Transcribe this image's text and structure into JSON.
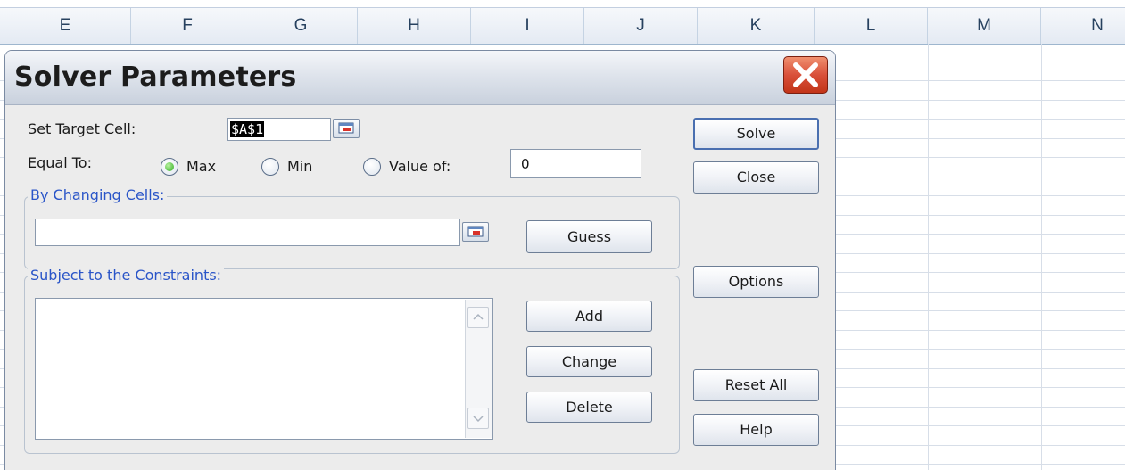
{
  "spreadsheet": {
    "columns": [
      "E",
      "F",
      "G",
      "H",
      "I",
      "J",
      "K",
      "L",
      "M",
      "N"
    ]
  },
  "dialog": {
    "title": "Solver Parameters",
    "close_icon": "close-icon",
    "set_target_cell": {
      "label": "Set Target Cell:",
      "value": "$A$1",
      "ref_icon": "range-select-icon"
    },
    "equal_to": {
      "label": "Equal To:",
      "options": [
        {
          "label": "Max",
          "selected": true
        },
        {
          "label": "Min",
          "selected": false
        },
        {
          "label": "Value of:",
          "selected": false
        }
      ],
      "value_of": "0"
    },
    "by_changing_cells": {
      "label": "By Changing Cells:",
      "value": "",
      "ref_icon": "range-select-icon"
    },
    "constraints": {
      "label": "Subject to the Constraints:",
      "items": []
    },
    "buttons": {
      "solve": "Solve",
      "close": "Close",
      "guess": "Guess",
      "options": "Options",
      "add": "Add",
      "change": "Change",
      "delete": "Delete",
      "reset_all": "Reset All",
      "help": "Help"
    }
  },
  "colors": {
    "accent_label": "#2a55c8",
    "radio_selected": "#2eae1e",
    "close_button": "#d9503a"
  }
}
